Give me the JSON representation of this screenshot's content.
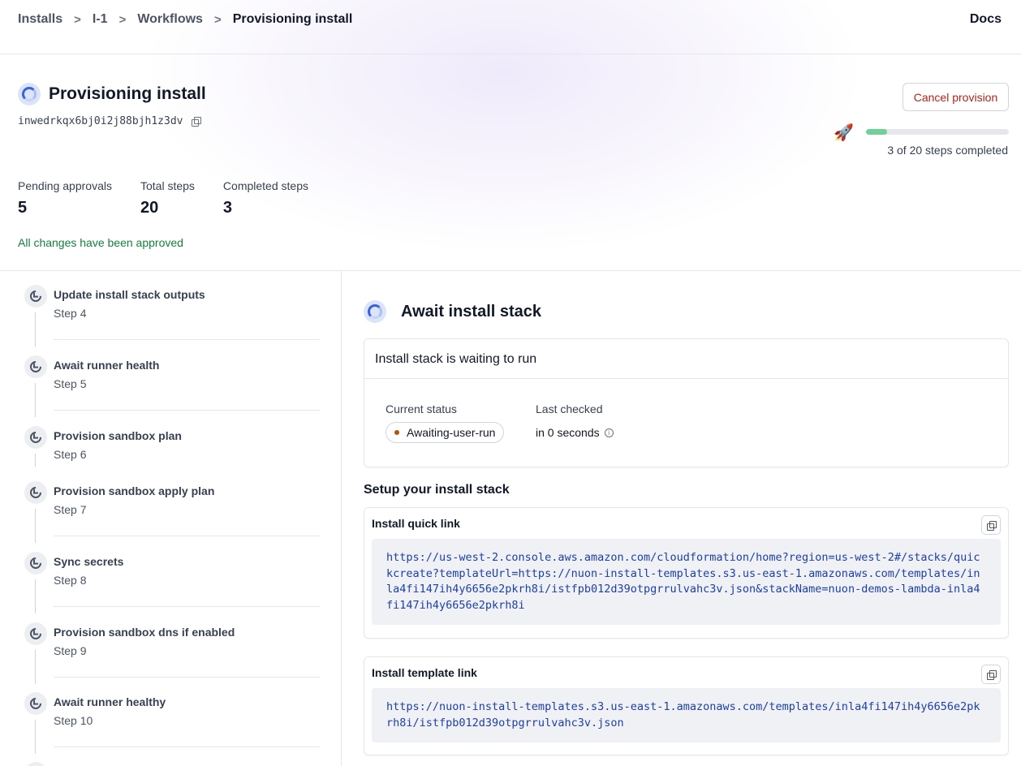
{
  "breadcrumbs": [
    {
      "label": "Installs"
    },
    {
      "label": "I-1"
    },
    {
      "label": "Workflows"
    },
    {
      "label": "Provisioning install"
    }
  ],
  "breadcrumb_separator": ">",
  "header": {
    "docs_label": "Docs"
  },
  "title": "Provisioning install",
  "install_id": "inwedrkqx6bj0i2j88bjh1z3dv",
  "cancel_label": "Cancel provision",
  "progress": {
    "completed": 3,
    "total": 20,
    "fraction": 0.15,
    "text": "3 of 20 steps completed",
    "icon": "rocket-icon",
    "color": "#6fd19a"
  },
  "stats": {
    "pending_label": "Pending approvals",
    "pending_value": "5",
    "total_label": "Total steps",
    "total_value": "20",
    "completed_label": "Completed steps",
    "completed_value": "3"
  },
  "approved_text": "All changes have been approved",
  "steps": [
    {
      "name": "Update install stack outputs",
      "num": "Step 4"
    },
    {
      "name": "Await runner health",
      "num": "Step 5"
    },
    {
      "name": "Provision sandbox plan",
      "num": "Step 6"
    },
    {
      "name": "Provision sandbox apply plan",
      "num": "Step 7"
    },
    {
      "name": "Sync secrets",
      "num": "Step 8"
    },
    {
      "name": "Provision sandbox dns if enabled",
      "num": "Step 9"
    },
    {
      "name": "Await runner healthy",
      "num": "Step 10"
    }
  ],
  "detail": {
    "title": "Await install stack",
    "status_card": {
      "heading": "Install stack is waiting to run",
      "current_status_label": "Current status",
      "current_status_value": "Awaiting-user-run",
      "status_color": "#b45309",
      "last_checked_label": "Last checked",
      "last_checked_value": "in 0 seconds"
    },
    "setup_title": "Setup your install stack",
    "quick_link": {
      "label": "Install quick link",
      "url": "https://us-west-2.console.aws.amazon.com/cloudformation/home?region=us-west-2#/stacks/quickcreate?templateUrl=https://nuon-install-templates.s3.us-east-1.amazonaws.com/templates/inla4fi147ih4y6656e2pkrh8i/istfpb012d39otpgrrulvahc3v.json&stackName=nuon-demos-lambda-inla4fi147ih4y6656e2pkrh8i"
    },
    "template_link": {
      "label": "Install template link",
      "url": "https://nuon-install-templates.s3.us-east-1.amazonaws.com/templates/inla4fi147ih4y6656e2pkrh8i/istfpb012d39otpgrrulvahc3v.json"
    }
  }
}
